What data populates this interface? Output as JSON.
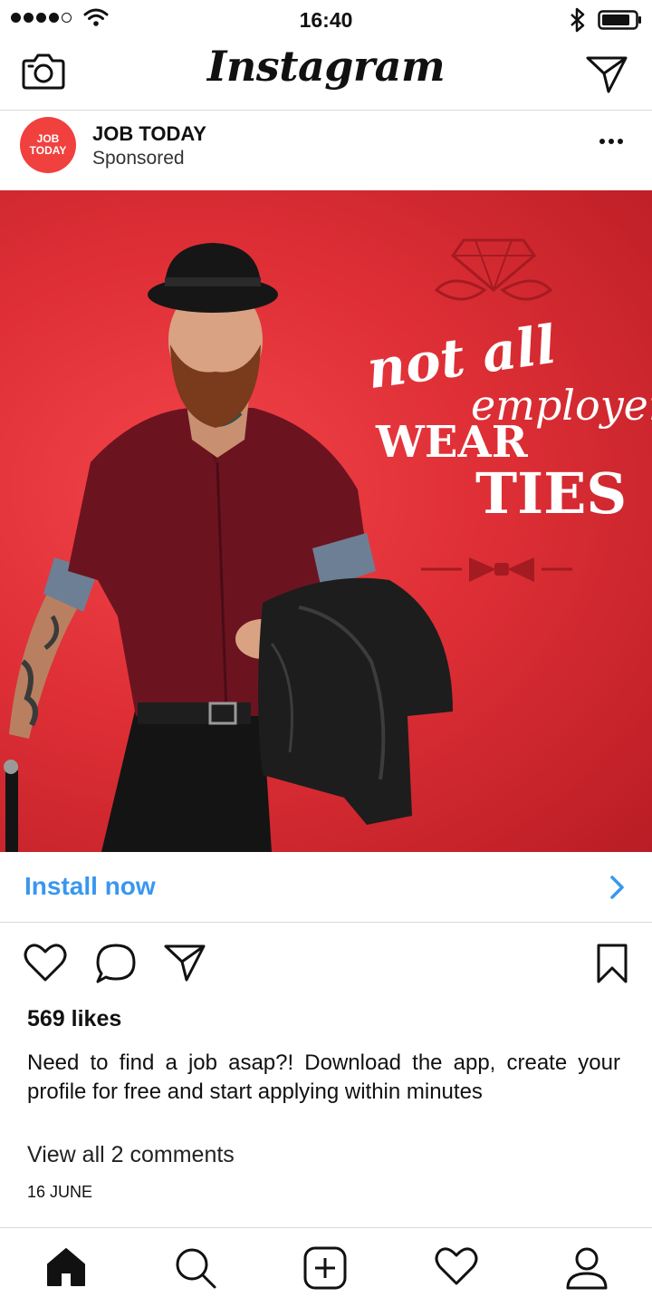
{
  "status_bar": {
    "time": "16:40"
  },
  "header": {
    "logo": "Instagram"
  },
  "post": {
    "account_name": "JOB TODAY",
    "sponsored": "Sponsored",
    "avatar_text_line1": "JOB",
    "avatar_text_line2": "TODAY",
    "ad_text": {
      "line1": "not all",
      "line2": "employers",
      "line3": "WEAR",
      "line4": "TIES"
    },
    "install_label": "Install now",
    "likes": "569 likes",
    "caption": "Need to find a job asap?! Download the app, create your profile for free and start applying within minutes",
    "view_comments": "View all 2 comments",
    "date": "16 JUNE"
  },
  "colors": {
    "accent": "#3897f0",
    "brand": "#f0413f",
    "ad_background": "#e0303a"
  },
  "icons": {
    "header": [
      "camera-icon",
      "direct-message-icon"
    ],
    "actions": [
      "heart-icon",
      "comment-icon",
      "share-icon",
      "bookmark-icon"
    ],
    "tabs": [
      "home-icon",
      "search-icon",
      "new-post-icon",
      "activity-icon",
      "profile-icon"
    ]
  }
}
